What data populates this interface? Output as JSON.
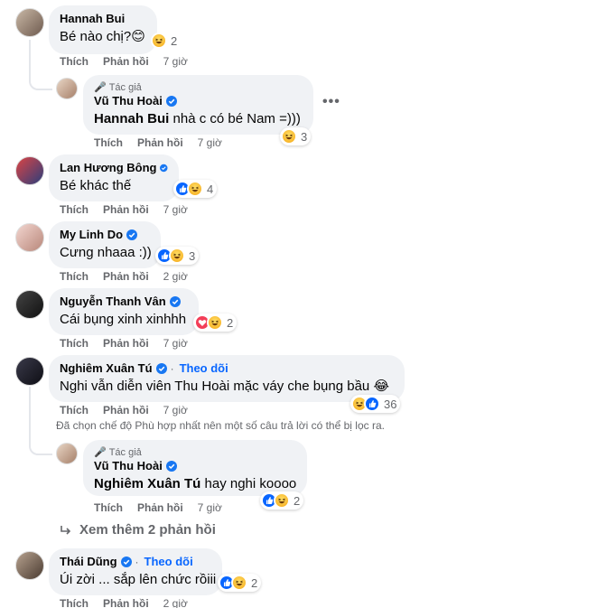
{
  "colors": {
    "bubble": "#f0f2f5",
    "secondary_text": "#65676b",
    "accent_blue": "#0866ff",
    "verified_blue": "#1877f2"
  },
  "labels": {
    "like": "Thích",
    "reply": "Phản hồi",
    "author_tag": "Tác giả",
    "follow": "Theo dõi"
  },
  "comments": [
    {
      "name": "Hannah Bui",
      "verified": false,
      "text": "Bé nào chị?",
      "emoji": "😊",
      "reactions": [
        "haha"
      ],
      "count": "2",
      "time": "7 giờ"
    },
    {
      "reply": true,
      "author_tag": true,
      "name": "Vũ Thu Hoài",
      "verified": true,
      "mention": "Hannah Bui",
      "text": " nhà c có bé Nam =)))",
      "reactions": [
        "haha"
      ],
      "count": "3",
      "time": "7 giờ"
    },
    {
      "name": "Lan Hương Bông",
      "verified": true,
      "text": "Bé khác thế",
      "reactions": [
        "like",
        "care"
      ],
      "count": "4",
      "time": "7 giờ"
    },
    {
      "name": "My Linh Do",
      "verified": true,
      "text": "Cưng nhaaa :))",
      "reactions": [
        "like",
        "haha"
      ],
      "count": "3",
      "time": "2 giờ"
    },
    {
      "name": "Nguyễn Thanh Vân",
      "verified": true,
      "text": "Cái bụng xinh xinhhh",
      "reactions": [
        "love",
        "care"
      ],
      "count": "2",
      "time": "7 giờ"
    },
    {
      "name": "Nghiêm Xuân Tú",
      "verified": true,
      "follow": true,
      "text": "Nghi vẫn diễn viên Thu Hoài mặc váy che bụng bầu",
      "emoji": "😂",
      "reactions": [
        "haha",
        "like"
      ],
      "count": "36",
      "time": "7 giờ"
    },
    {
      "reply": true,
      "author_tag": true,
      "name": "Vũ Thu Hoài",
      "verified": true,
      "mention": "Nghiêm Xuân Tú",
      "text": " hay nghi koooo",
      "reactions": [
        "like",
        "haha"
      ],
      "count": "2",
      "time": "7 giờ"
    },
    {
      "name": "Thái Dũng",
      "verified": true,
      "follow": true,
      "text": "Úi zời ... sắp lên chức rồiii",
      "reactions": [
        "like",
        "haha"
      ],
      "count": "2",
      "time": "2 giờ"
    }
  ],
  "filter_note": "Đã chọn chế độ Phù hợp nhất nên một số câu trả lời có thể bị lọc ra.",
  "see_more": "Xem thêm 2 phản hồi",
  "more_dots": "•••"
}
